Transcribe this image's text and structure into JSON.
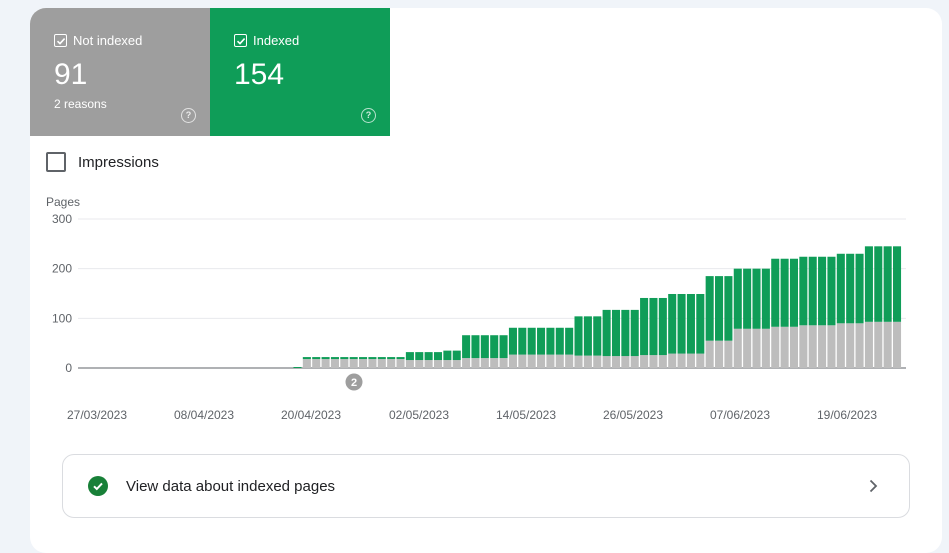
{
  "tiles": {
    "not_indexed": {
      "label": "Not indexed",
      "value": "91",
      "sub": "2 reasons",
      "help": "?",
      "color": "#9e9e9e"
    },
    "indexed": {
      "label": "Indexed",
      "value": "154",
      "help": "?",
      "color": "#0f9d58"
    }
  },
  "impressions": {
    "label": "Impressions",
    "checked": false
  },
  "chart_data": {
    "type": "bar",
    "stacked": true,
    "ylabel": "Pages",
    "ylim": [
      0,
      300
    ],
    "yticks": [
      0,
      100,
      200,
      300
    ],
    "xtick_labels": [
      "27/03/2023",
      "08/04/2023",
      "20/04/2023",
      "02/05/2023",
      "14/05/2023",
      "26/05/2023",
      "07/06/2023",
      "19/06/2023"
    ],
    "series": [
      {
        "color": "#bdbdbd",
        "values": [
          0,
          0,
          0,
          0,
          0,
          0,
          0,
          0,
          0,
          0,
          0,
          0,
          0,
          0,
          0,
          0,
          0,
          0,
          0,
          0,
          0,
          0,
          0,
          0,
          18,
          18,
          18,
          18,
          18,
          18,
          18,
          18,
          18,
          18,
          18,
          16,
          16,
          16,
          16,
          16,
          16,
          20,
          20,
          20,
          20,
          20,
          27,
          27,
          27,
          27,
          27,
          27,
          27,
          25,
          25,
          25,
          24,
          24,
          24,
          24,
          26,
          26,
          26,
          29,
          29,
          29,
          29,
          55,
          55,
          55,
          79,
          79,
          79,
          79,
          83,
          83,
          83,
          86,
          86,
          86,
          86,
          90,
          90,
          90,
          93,
          93,
          93,
          93
        ]
      },
      {
        "color": "#0f9d58",
        "values": [
          0,
          0,
          0,
          0,
          0,
          0,
          0,
          0,
          0,
          0,
          0,
          0,
          0,
          0,
          0,
          0,
          0,
          0,
          0,
          0,
          0,
          0,
          0,
          2,
          4,
          4,
          4,
          4,
          4,
          4,
          4,
          4,
          4,
          4,
          4,
          16,
          16,
          16,
          16,
          19,
          19,
          46,
          46,
          46,
          46,
          46,
          54,
          54,
          54,
          54,
          54,
          54,
          54,
          79,
          79,
          79,
          93,
          93,
          93,
          93,
          115,
          115,
          115,
          120,
          120,
          120,
          120,
          130,
          130,
          130,
          121,
          121,
          121,
          121,
          137,
          137,
          137,
          138,
          138,
          138,
          138,
          140,
          140,
          140,
          152,
          152,
          152,
          152
        ]
      }
    ],
    "annotation": {
      "text": "2"
    }
  },
  "link": {
    "label": "View data about indexed pages"
  }
}
